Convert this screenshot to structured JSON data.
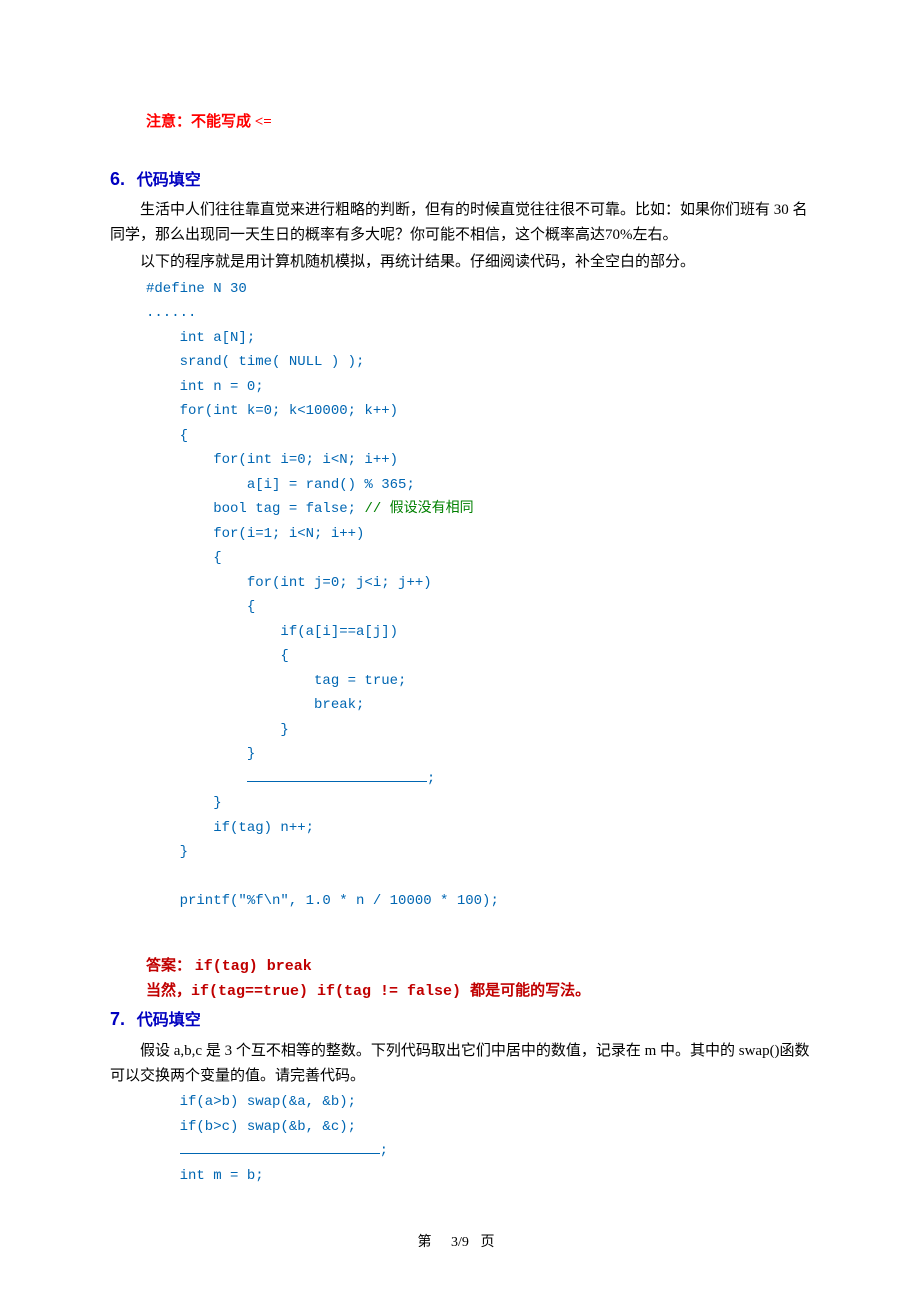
{
  "note_top": "注意：不能写成 <=",
  "q6": {
    "num": "6.",
    "title": "代码填空",
    "p1": "生活中人们往往靠直觉来进行粗略的判断，但有的时候直觉往往很不可靠。比如：如果你们班有 30 名同学，那么出现同一天生日的概率有多大呢？你可能不相信，这个概率高达70%左右。",
    "p2": "以下的程序就是用计算机随机模拟，再统计结果。仔细阅读代码，补全空白的部分。",
    "code": {
      "l1": "#define N 30",
      "l2": "......",
      "l3": "    int a[N];",
      "l4": "    srand( time( NULL ) );",
      "l5": "    int n = 0;",
      "l6": "    for(int k=0; k<10000; k++)",
      "l7": "    {",
      "l8": "        for(int i=0; i<N; i++)",
      "l9": "            a[i] = rand() % 365;",
      "l10a": "        bool tag = false; ",
      "l10b": "// 假设没有相同",
      "l11": "        for(i=1; i<N; i++)",
      "l12": "        {",
      "l13": "            for(int j=0; j<i; j++)",
      "l14": "            {",
      "l15": "                if(a[i]==a[j])",
      "l16": "                {",
      "l17": "                    tag = true;",
      "l18": "                    break;",
      "l19": "                }",
      "l20": "            }",
      "l21a": "            ",
      "l21b": ";",
      "l22": "        }",
      "l23": "        if(tag) n++;",
      "l24": "    }",
      "l25": "",
      "l26": "    printf(\"%f\\n\", 1.0 * n / 10000 * 100);"
    },
    "answer_label": "答案：  ",
    "answer_code": "if(tag) break",
    "answer_p2a": "当然，",
    "answer_p2b": "if(tag==true)    if(tag != false) ",
    "answer_p2c": "都是可能的写法。"
  },
  "q7": {
    "num": "7.",
    "title": "代码填空",
    "p1": "假设 a,b,c 是 3 个互不相等的整数。下列代码取出它们中居中的数值，记录在 m 中。其中的 swap()函数可以交换两个变量的值。请完善代码。",
    "code": {
      "l1": "    if(a>b) swap(&a, &b);",
      "l2": "    if(b>c) swap(&b, &c);",
      "l3a": "    ",
      "l3b": ";",
      "l4": "    int m = b;"
    }
  },
  "footer": {
    "prefix": "第",
    "page": "3/9",
    "suffix": "页"
  }
}
